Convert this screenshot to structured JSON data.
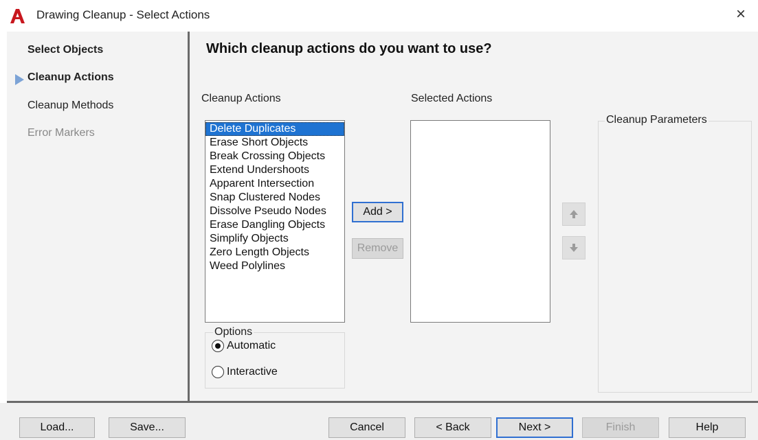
{
  "window": {
    "title": "Drawing Cleanup - Select Actions",
    "close_glyph": "×",
    "accent": "#1e73d2",
    "logo_color": "#c8171e"
  },
  "sidebar": {
    "items": [
      {
        "label": "Select Objects",
        "state": "normal"
      },
      {
        "label": "Cleanup Actions",
        "state": "current"
      },
      {
        "label": "Cleanup Methods",
        "state": "normal"
      },
      {
        "label": "Error Markers",
        "state": "disabled"
      }
    ]
  },
  "main": {
    "heading": "Which cleanup actions do you want to use?",
    "cleanup_actions_label": "Cleanup Actions",
    "cleanup_actions": [
      "Delete Duplicates",
      "Erase Short Objects",
      "Break Crossing Objects",
      "Extend Undershoots",
      "Apparent Intersection",
      "Snap Clustered Nodes",
      "Dissolve Pseudo Nodes",
      "Erase Dangling Objects",
      "Simplify Objects",
      "Zero Length Objects",
      "Weed Polylines"
    ],
    "selected_index": 0,
    "selected_actions_label": "Selected Actions",
    "selected_actions": [],
    "add_label": "Add >",
    "remove_label": "Remove",
    "move_up_icon": "arrow-up-icon",
    "move_down_icon": "arrow-down-icon",
    "parameters_label": "Cleanup Parameters",
    "options": {
      "label": "Options",
      "automatic": "Automatic",
      "interactive": "Interactive",
      "selected": "Automatic"
    }
  },
  "footer": {
    "load": "Load...",
    "save": "Save...",
    "cancel": "Cancel",
    "back": "< Back",
    "next": "Next >",
    "finish": "Finish",
    "help": "Help"
  }
}
